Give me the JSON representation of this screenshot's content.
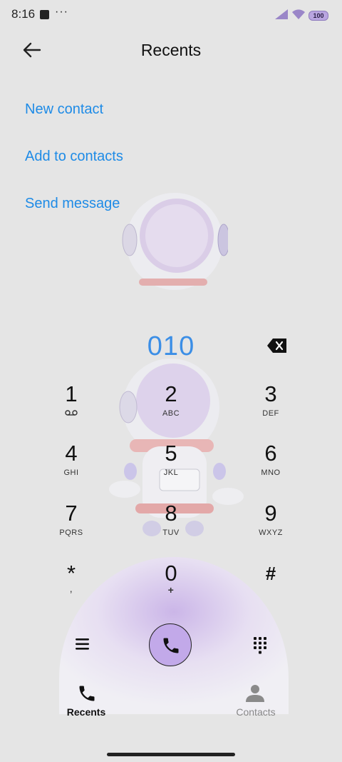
{
  "status_bar": {
    "time": "8:16",
    "more": "···",
    "battery": "100"
  },
  "header": {
    "title": "Recents"
  },
  "actions": [
    {
      "label": "New contact"
    },
    {
      "label": "Add to contacts"
    },
    {
      "label": "Send message"
    }
  ],
  "dial": {
    "number": "010"
  },
  "keypad": [
    {
      "digit": "1",
      "letters": ""
    },
    {
      "digit": "2",
      "letters": "ABC"
    },
    {
      "digit": "3",
      "letters": "DEF"
    },
    {
      "digit": "4",
      "letters": "GHI"
    },
    {
      "digit": "5",
      "letters": "JKL"
    },
    {
      "digit": "6",
      "letters": "MNO"
    },
    {
      "digit": "7",
      "letters": "PQRS"
    },
    {
      "digit": "8",
      "letters": "TUV"
    },
    {
      "digit": "9",
      "letters": "WXYZ"
    },
    {
      "digit": "*",
      "letters": ","
    },
    {
      "digit": "0",
      "letters": "+"
    },
    {
      "digit": "#",
      "letters": ""
    }
  ],
  "nav": {
    "recents": "Recents",
    "contacts": "Contacts"
  },
  "colors": {
    "accent": "#1e8be6",
    "call_button": "#c2a9e9",
    "background": "#e5e5e5"
  },
  "icons": [
    "back-arrow-icon",
    "backspace-icon",
    "voicemail-icon",
    "menu-icon",
    "phone-icon",
    "dialpad-icon",
    "contact-person-icon",
    "signal-icon",
    "wifi-icon"
  ]
}
